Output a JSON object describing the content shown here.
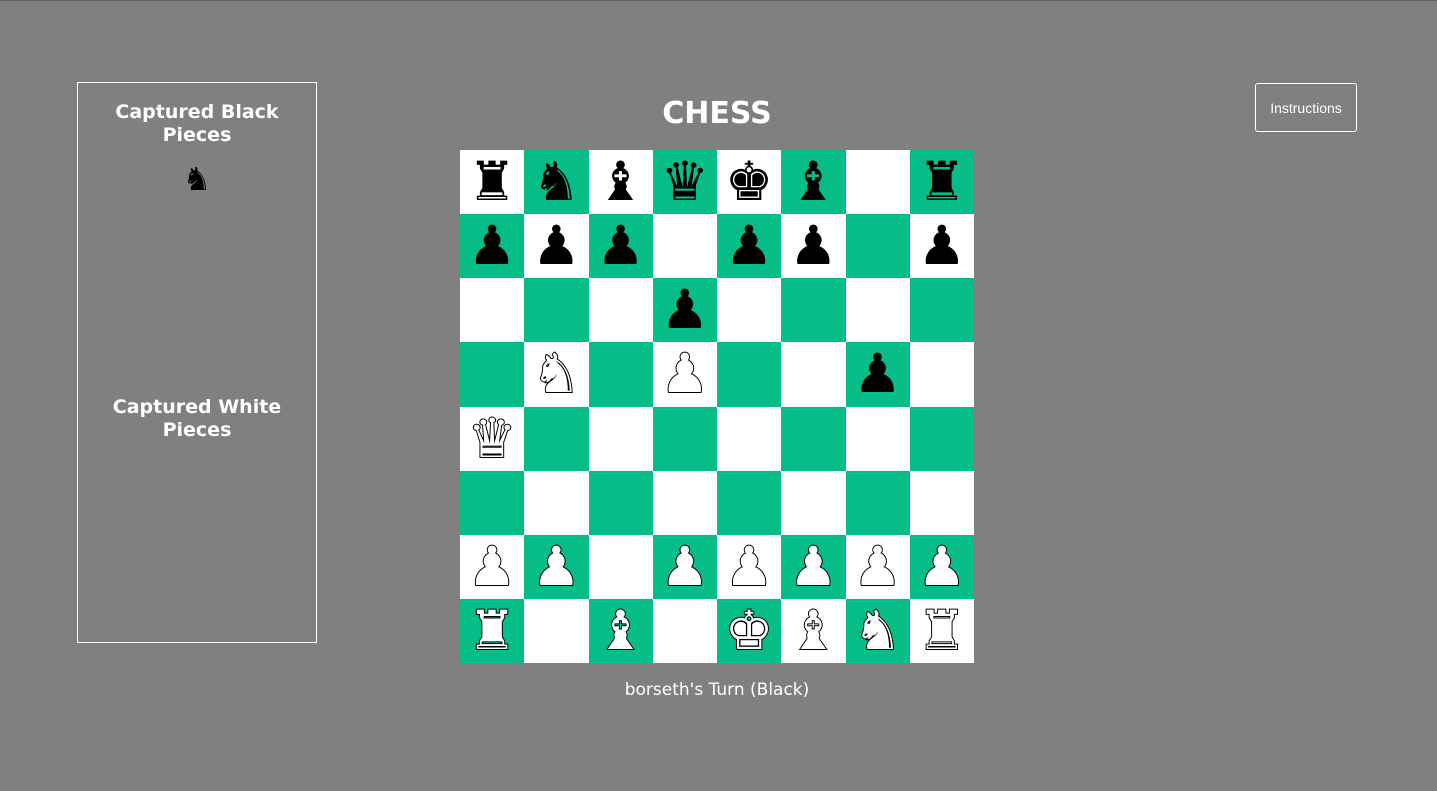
{
  "title": "CHESS",
  "instructions_button": "Instructions",
  "captured_black": {
    "title": "Captured Black Pieces",
    "pieces": [
      {
        "type": "knight",
        "color": "black"
      }
    ]
  },
  "captured_white": {
    "title": "Captured White Pieces",
    "pieces": []
  },
  "turn_status": "borseth's Turn (Black)",
  "colors": {
    "background": "#808080",
    "light_square": "#ffffff",
    "dark_square": "#06bd87"
  },
  "board": [
    [
      "black-rook",
      "black-knight",
      "black-bishop",
      "black-queen",
      "black-king",
      "black-bishop",
      "",
      "black-rook"
    ],
    [
      "black-pawn",
      "black-pawn",
      "black-pawn",
      "",
      "black-pawn",
      "black-pawn",
      "",
      "black-pawn"
    ],
    [
      "",
      "",
      "",
      "black-pawn",
      "",
      "",
      "",
      ""
    ],
    [
      "",
      "white-knight",
      "",
      "white-pawn",
      "",
      "",
      "black-pawn",
      ""
    ],
    [
      "white-queen",
      "",
      "",
      "",
      "",
      "",
      "",
      ""
    ],
    [
      "",
      "",
      "",
      "",
      "",
      "",
      "",
      ""
    ],
    [
      "white-pawn",
      "white-pawn",
      "",
      "white-pawn",
      "white-pawn",
      "white-pawn",
      "white-pawn",
      "white-pawn"
    ],
    [
      "white-rook",
      "",
      "white-bishop",
      "",
      "white-king",
      "white-bishop",
      "white-knight",
      "white-rook"
    ]
  ]
}
